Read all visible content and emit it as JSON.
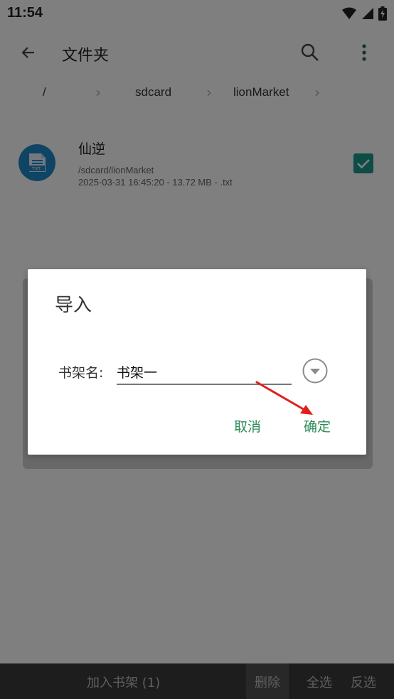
{
  "status": {
    "time": "11:54"
  },
  "toolbar": {
    "title": "文件夹"
  },
  "breadcrumb": [
    "/",
    "sdcard",
    "lionMarket"
  ],
  "file": {
    "name": "仙逆",
    "path": "/sdcard/lionMarket",
    "meta": "2025-03-31 16:45:20 - 13.72 MB - .txt",
    "icon_text": "TXT",
    "checked": true
  },
  "bottom_bar": {
    "add": "加入书架 (1)",
    "delete": "删除",
    "select_all": "全选",
    "invert": "反选"
  },
  "dialog": {
    "title": "导入",
    "label": "书架名:",
    "value": "书架一",
    "cancel": "取消",
    "ok": "确定"
  },
  "colors": {
    "accent": "#2e8b57",
    "check": "#1b9a8a",
    "file_icon": "#1e88c8",
    "annotation_arrow": "#e0201c"
  }
}
